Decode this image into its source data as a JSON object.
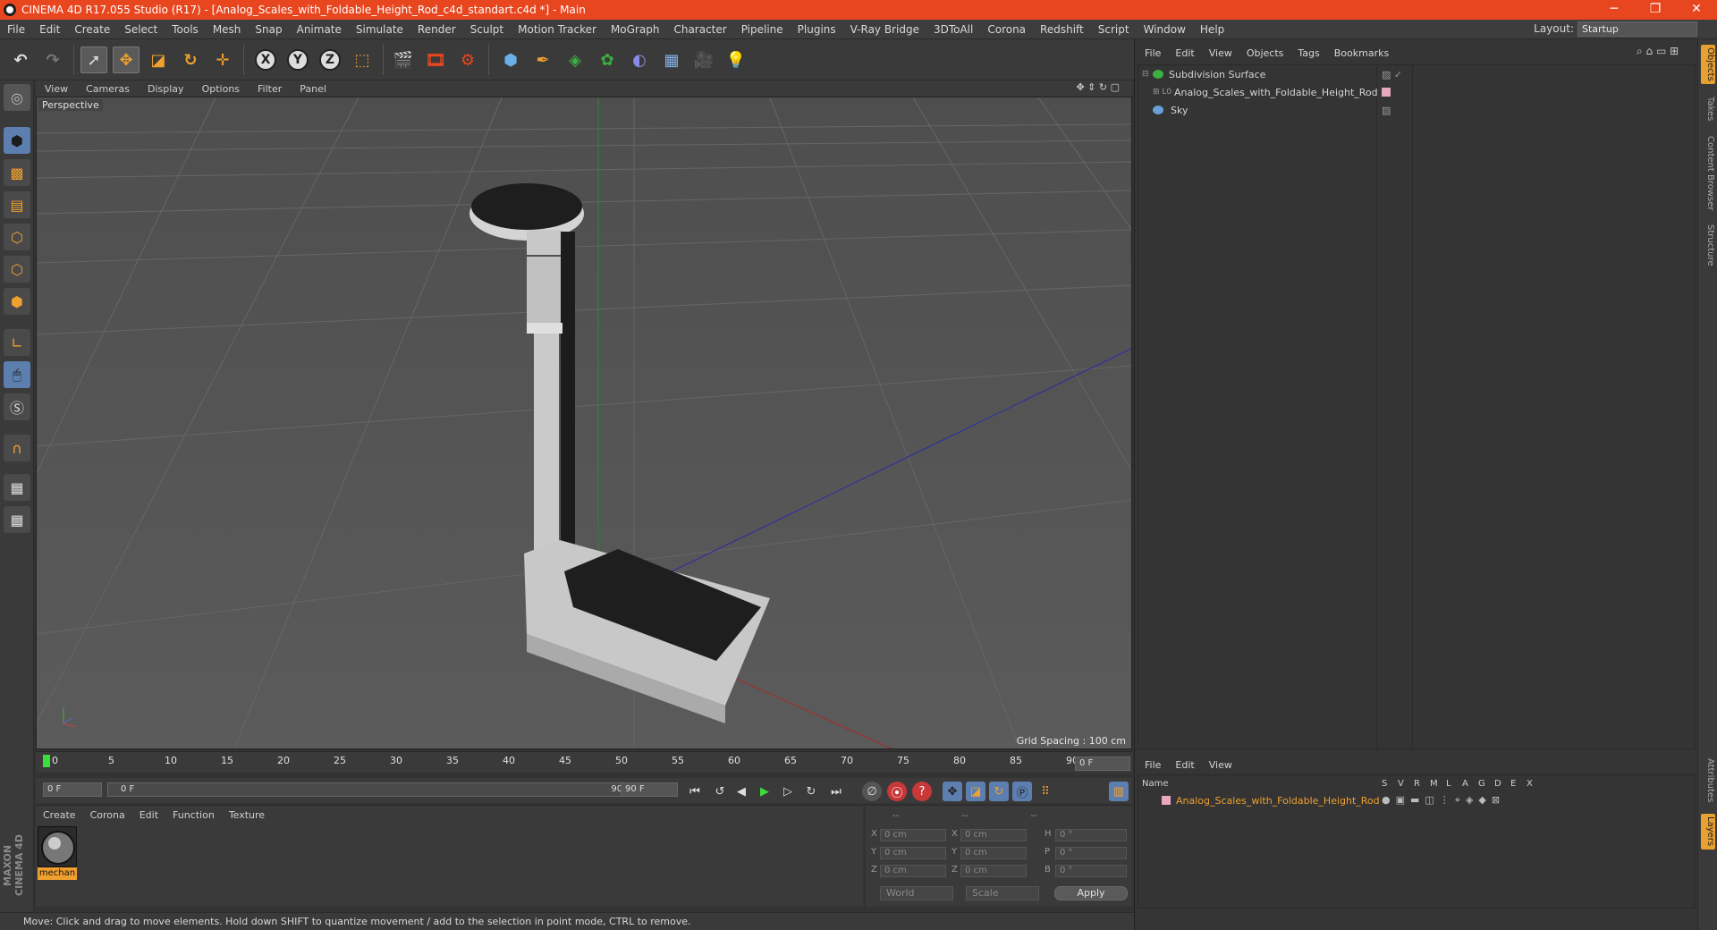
{
  "window": {
    "title": "CINEMA 4D R17.055 Studio (R17) - [Analog_Scales_with_Foldable_Height_Rod_c4d_standart.c4d *] - Main",
    "controls": [
      "─",
      "❐",
      "✕"
    ]
  },
  "menu": [
    "File",
    "Edit",
    "Create",
    "Select",
    "Tools",
    "Mesh",
    "Snap",
    "Animate",
    "Simulate",
    "Render",
    "Sculpt",
    "Motion Tracker",
    "MoGraph",
    "Character",
    "Pipeline",
    "Plugins",
    "V-Ray Bridge",
    "3DToAll",
    "Corona",
    "Redshift",
    "Script",
    "Window",
    "Help"
  ],
  "layout": {
    "label": "Layout:",
    "value": "Startup"
  },
  "toolbar": {
    "icons": [
      "undo-icon",
      "redo-icon",
      "select-icon",
      "move-icon",
      "scale-icon",
      "rotate-icon",
      "transform-icon",
      "x-axis-icon",
      "y-axis-icon",
      "z-axis-icon",
      "coordinate-system-icon",
      "render-view-icon",
      "render-picture-viewer-icon",
      "render-settings-icon",
      "cube-icon",
      "pen-icon",
      "subdivision-icon",
      "mograph-icon",
      "deformer-icon",
      "floor-icon",
      "camera-icon",
      "light-icon"
    ],
    "axis_labels": [
      "X",
      "Y",
      "Z"
    ]
  },
  "viewport": {
    "menu": [
      "View",
      "Cameras",
      "Display",
      "Options",
      "Filter",
      "Panel"
    ],
    "label": "Perspective",
    "grid_spacing": "Grid Spacing : 100 cm"
  },
  "timeline": {
    "ticks": [
      "0",
      "5",
      "10",
      "15",
      "20",
      "25",
      "30",
      "35",
      "40",
      "45",
      "50",
      "55",
      "60",
      "65",
      "70",
      "75",
      "80",
      "85",
      "90"
    ],
    "current_frame": "0 F",
    "start_field": "0 F",
    "range_start": "0 F",
    "range_end": "90 F",
    "end_field": "90 F"
  },
  "material_manager": {
    "menu": [
      "Create",
      "Corona",
      "Edit",
      "Function",
      "Texture"
    ],
    "materials": [
      {
        "name": "mechan"
      }
    ]
  },
  "coordinates": {
    "header": [
      "--",
      "--",
      "--"
    ],
    "rows": [
      {
        "axis": "X",
        "pos": "0 cm",
        "axis2": "X",
        "size": "0 cm",
        "rlabel": "H",
        "rot": "0 °"
      },
      {
        "axis": "Y",
        "pos": "0 cm",
        "axis2": "Y",
        "size": "0 cm",
        "rlabel": "P",
        "rot": "0 °"
      },
      {
        "axis": "Z",
        "pos": "0 cm",
        "axis2": "Z",
        "size": "0 cm",
        "rlabel": "B",
        "rot": "0 °"
      }
    ],
    "mode": "World",
    "scale": "Scale",
    "apply": "Apply"
  },
  "status": "Move: Click and drag to move elements. Hold down SHIFT to quantize movement / add to the selection in point mode, CTRL to remove.",
  "object_manager": {
    "menu": [
      "File",
      "Edit",
      "View",
      "Objects",
      "Tags",
      "Bookmarks"
    ],
    "objects": [
      {
        "name": "Subdivision Surface",
        "color": "#3cb043"
      },
      {
        "name": "Analog_Scales_with_Foldable_Height_Rod",
        "color": "#dddddd"
      },
      {
        "name": "Sky",
        "color": "#6aa0d8"
      }
    ]
  },
  "layers_manager": {
    "menu": [
      "File",
      "Edit",
      "View"
    ],
    "columns": [
      "Name",
      "S",
      "V",
      "R",
      "M",
      "L",
      "A",
      "G",
      "D",
      "E",
      "X"
    ],
    "layers": [
      {
        "name": "Analog_Scales_with_Foldable_Height_Rod",
        "color": "#f0a030"
      }
    ]
  },
  "side_tabs": [
    "Objects",
    "Takes",
    "Content Browser",
    "Structure",
    "Attributes",
    "Layers"
  ],
  "brand": "MAXON CINEMA 4D",
  "colors": {
    "accent": "#e8461f",
    "highlight": "#f0a030",
    "select_blue": "#5d7fb0"
  }
}
